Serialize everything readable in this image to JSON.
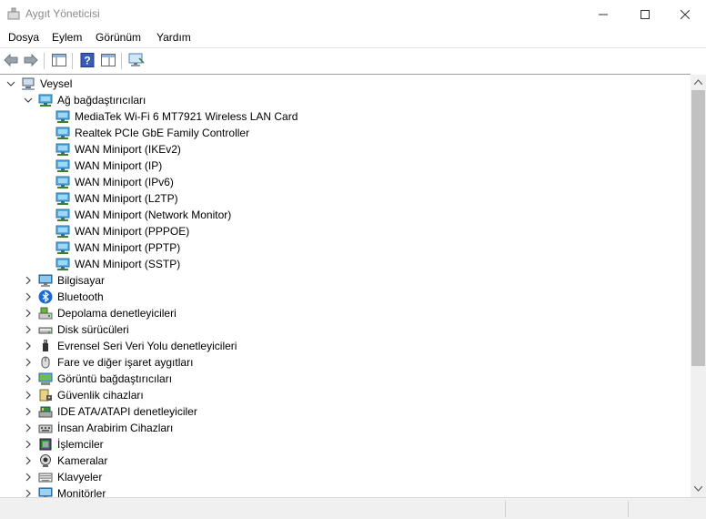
{
  "window": {
    "title": "Aygıt Yöneticisi"
  },
  "menu": [
    "Dosya",
    "Eylem",
    "Görünüm",
    "Yardım"
  ],
  "tree": {
    "root": "Veysel",
    "network": {
      "label": "Ağ bağdaştırıcıları",
      "devices": [
        "MediaTek Wi-Fi 6 MT7921 Wireless LAN Card",
        "Realtek PCIe GbE Family Controller",
        "WAN Miniport (IKEv2)",
        "WAN Miniport (IP)",
        "WAN Miniport (IPv6)",
        "WAN Miniport (L2TP)",
        "WAN Miniport (Network Monitor)",
        "WAN Miniport (PPPOE)",
        "WAN Miniport (PPTP)",
        "WAN Miniport (SSTP)"
      ]
    },
    "categories": [
      "Bilgisayar",
      "Bluetooth",
      "Depolama denetleyicileri",
      "Disk sürücüleri",
      "Evrensel Seri Veri Yolu denetleyicileri",
      "Fare ve diğer işaret aygıtları",
      "Görüntü bağdaştırıcıları",
      "Güvenlik cihazları",
      "IDE ATA/ATAPI denetleyiciler",
      "İnsan Arabirim Cihazları",
      "İşlemciler",
      "Kameralar",
      "Klavyeler",
      "Monitörler"
    ],
    "category_icons": [
      "computer-icon",
      "bluetooth-icon",
      "storage-controller-icon",
      "disk-drive-icon",
      "usb-icon",
      "mouse-icon",
      "display-adapter-icon",
      "security-device-icon",
      "ide-controller-icon",
      "hid-icon",
      "processor-icon",
      "camera-icon",
      "keyboard-icon",
      "monitor-icon"
    ]
  }
}
